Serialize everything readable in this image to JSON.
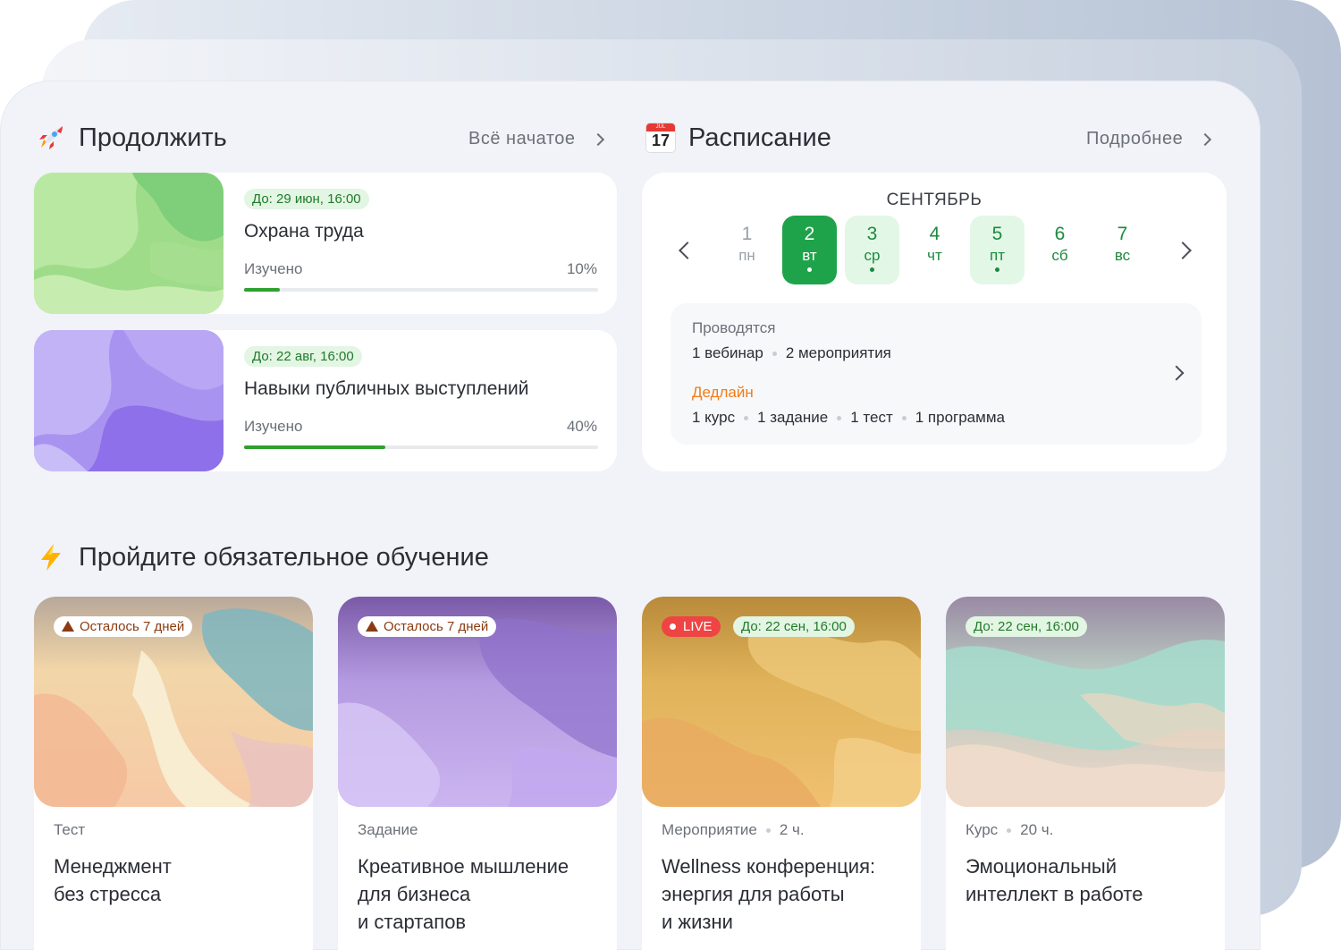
{
  "continue": {
    "title": "Продолжить",
    "link": "Всё начатое",
    "icon": "rocket-icon",
    "courses": [
      {
        "deadline": "До: 29 июн, 16:00",
        "title": "Охрана труда",
        "studied_label": "Изучено",
        "percent": "10%",
        "progress": 0.1
      },
      {
        "deadline": "До: 22 авг, 16:00",
        "title": "Навыки публичных выступлений",
        "studied_label": "Изучено",
        "percent": "40%",
        "progress": 0.4
      }
    ]
  },
  "schedule": {
    "title": "Расписание",
    "link": "Подробнее",
    "icon": "calendar-icon",
    "icon_month": "JUL",
    "icon_day": "17",
    "month": "СЕНТЯБРЬ",
    "days": [
      {
        "num": "1",
        "wd": "пн",
        "state": "past",
        "dot": false
      },
      {
        "num": "2",
        "wd": "вт",
        "state": "selected",
        "dot": true
      },
      {
        "num": "3",
        "wd": "ср",
        "state": "event",
        "dot": true
      },
      {
        "num": "4",
        "wd": "чт",
        "state": "normal",
        "dot": false
      },
      {
        "num": "5",
        "wd": "пт",
        "state": "event",
        "dot": true
      },
      {
        "num": "6",
        "wd": "сб",
        "state": "normal",
        "dot": false
      },
      {
        "num": "7",
        "wd": "вс",
        "state": "normal",
        "dot": false
      }
    ],
    "ongoing_label": "Проводятся",
    "ongoing": [
      "1 вебинар",
      "2 мероприятия"
    ],
    "deadline_label": "Дедлайн",
    "deadlines": [
      "1 курс",
      "1 задание",
      "1 тест",
      "1 программа"
    ]
  },
  "mandatory": {
    "title": "Пройдите обязательное обучение",
    "icon": "lightning-icon",
    "cards": [
      {
        "badge": "Осталось 7 дней",
        "type": "Тест",
        "duration": "",
        "title": "Менеджмент\nбез стресса"
      },
      {
        "badge": "Осталось 7 дней",
        "type": "Задание",
        "duration": "",
        "title": "Креативное мышление\nдля бизнеса\nи стартапов"
      },
      {
        "live": "LIVE",
        "badge": "До: 22 сен, 16:00",
        "type": "Мероприятие",
        "duration": "2 ч.",
        "title": "Wellness конференция:\nэнергия для работы\nи жизни"
      },
      {
        "badge": "До: 22 сен, 16:00",
        "type": "Курс",
        "duration": "20 ч.",
        "title": "Эмоциональный\nинтеллект в работе"
      }
    ]
  },
  "colors": {
    "accent": "#1fa34a",
    "accent_light": "#e3f7e6",
    "deadline": "#f07b1a",
    "progress": "#2ea12e"
  }
}
